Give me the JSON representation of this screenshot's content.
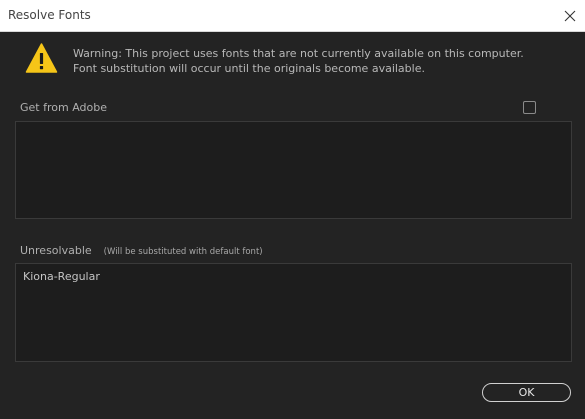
{
  "window": {
    "title": "Resolve Fonts",
    "close_icon": "close-icon"
  },
  "warning": {
    "icon": "warning-icon",
    "icon_color": "#f5c518",
    "text": "Warning: This project uses fonts that are not currently available on this computer. Font substitution will occur until the originals become available."
  },
  "sections": {
    "get_from_adobe": {
      "label": "Get from Adobe",
      "checkbox_checked": false,
      "items": []
    },
    "unresolvable": {
      "label": "Unresolvable",
      "hint": "(Will be substituted with default font)",
      "items": [
        "Kiona-Regular"
      ]
    }
  },
  "buttons": {
    "ok_label": "OK"
  },
  "colors": {
    "background": "#232323",
    "panel": "#1d1d1d",
    "titlebar": "#ffffff"
  }
}
